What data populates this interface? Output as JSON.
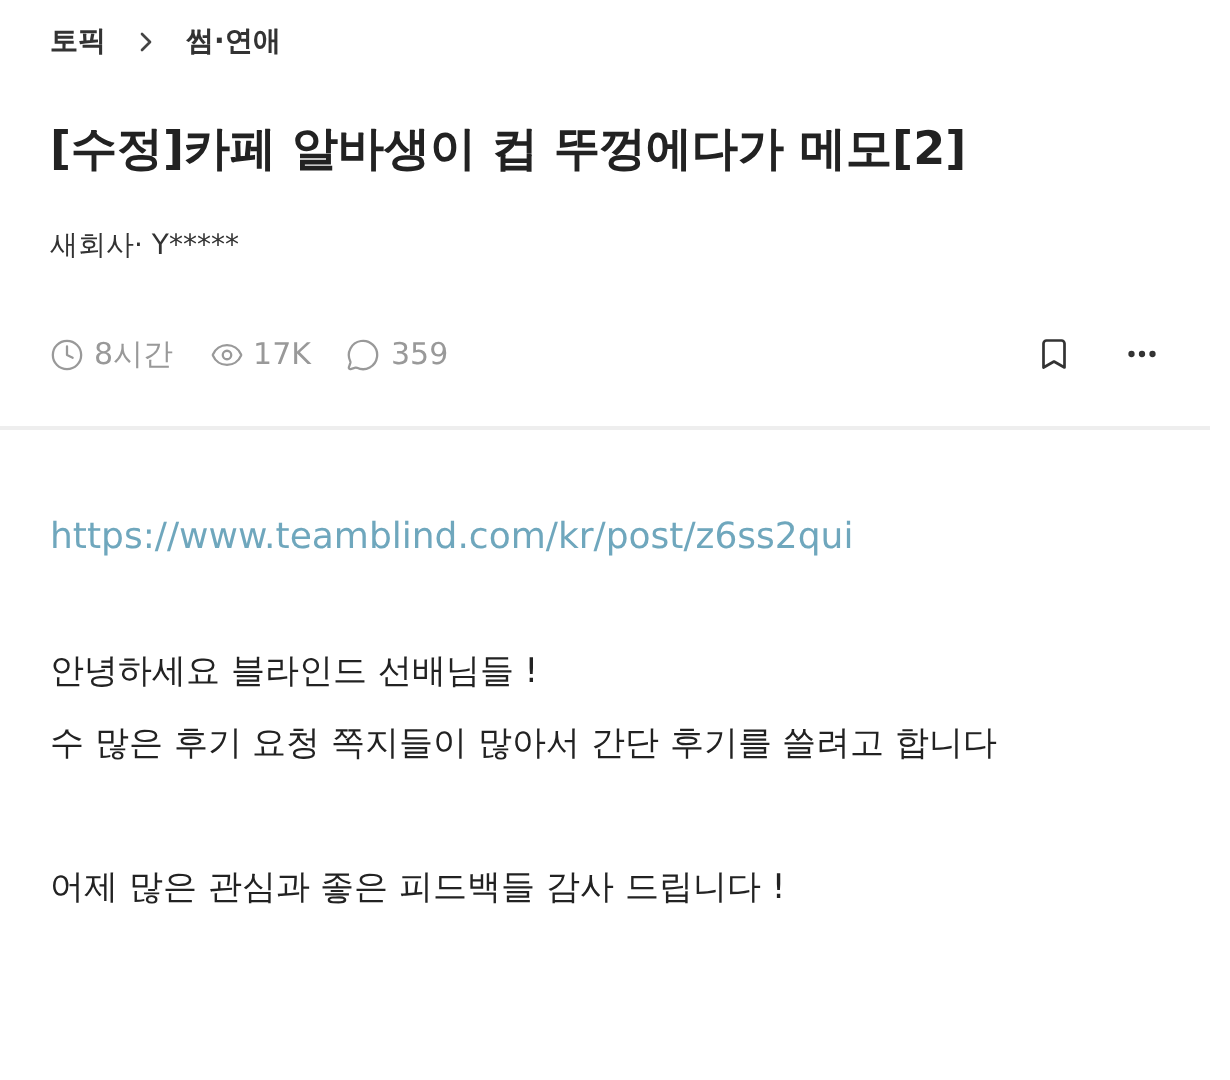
{
  "breadcrumb": [
    "토픽",
    "썸·연애"
  ],
  "title": "[수정]카페 알바생이 컵 뚜껑에다가 메모[2]",
  "author": "새회사· Y*****",
  "meta": [
    {
      "kind": "time",
      "text": "8시간"
    },
    {
      "kind": "views",
      "text": "17K"
    },
    {
      "kind": "comments",
      "text": "359"
    }
  ],
  "link": "https://www.teamblind.com/kr/post/z6ss2qui",
  "paragraphs": [
    [
      "안녕하세요 블라인드 선배님들 !",
      "수 많은 후기 요청 쪽지들이 많아서 간단 후기를 쓸려고 합니다"
    ],
    [
      "어제 많은 관심과 좋은 피드백들 감사 드립니다 !"
    ]
  ]
}
